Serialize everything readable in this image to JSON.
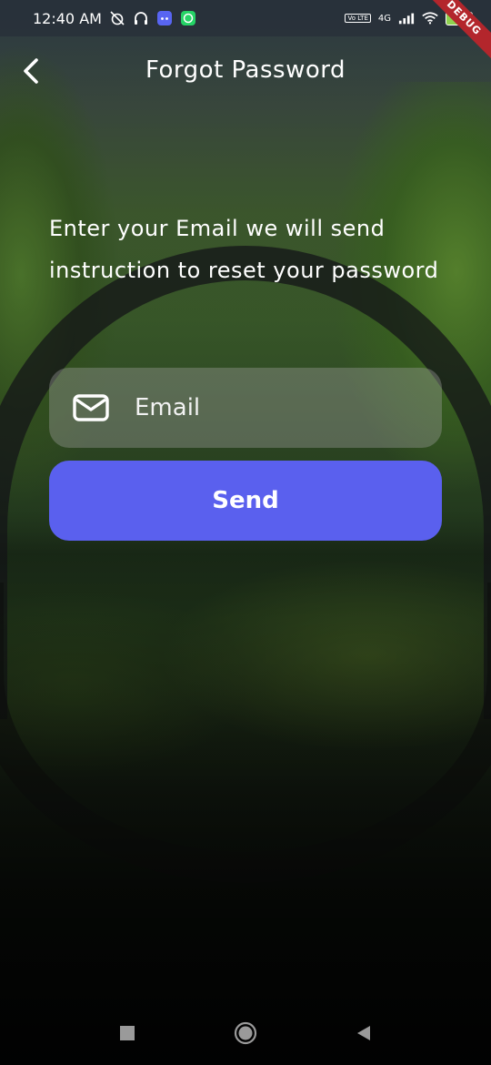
{
  "status_bar": {
    "time": "12:40 AM",
    "network": "4G",
    "volte_label": "Vo LTE",
    "battery_level": "55",
    "debug_label": "DEBUG"
  },
  "app_bar": {
    "title": "Forgot Password"
  },
  "main": {
    "instruction": "Enter your Email we will send instruction to reset your password",
    "email_input": {
      "value": "",
      "placeholder": "Email",
      "icon": "envelope-icon"
    },
    "send_label": "Send"
  },
  "colors": {
    "accent": "#5a60ee",
    "field_bg": "rgba(160,160,160,0.38)",
    "debug_ribbon": "#b3262c",
    "battery_fill": "#8fd14f"
  }
}
